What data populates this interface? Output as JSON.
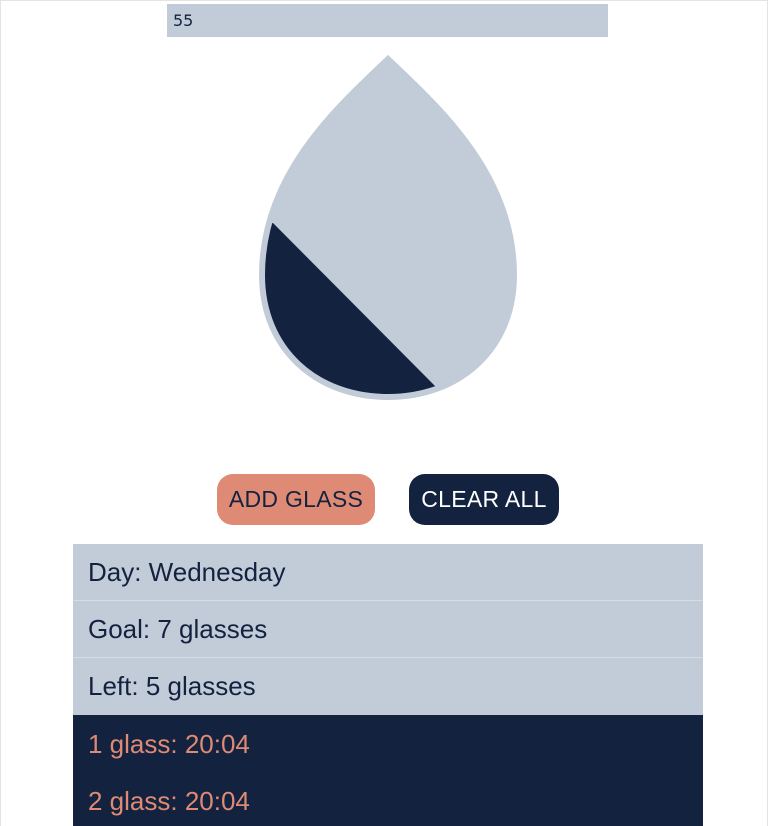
{
  "input": {
    "value": "55"
  },
  "drop": {
    "fill_fraction": 0.286,
    "colors": {
      "empty": "#c2ccd9",
      "filled": "#13223f"
    }
  },
  "buttons": {
    "add_label": "ADD GLASS",
    "clear_label": "CLEAR ALL",
    "add_color": "#df8a74",
    "clear_color": "#13223f"
  },
  "info": {
    "day": "Day: Wednesday",
    "goal": "Goal: 7 glasses",
    "left": "Left: 5 glasses"
  },
  "log": [
    "1 glass: 20:04",
    "2 glass: 20:04"
  ]
}
